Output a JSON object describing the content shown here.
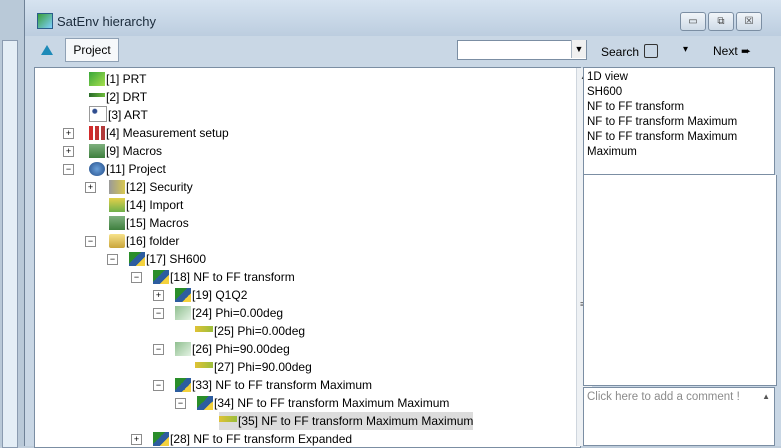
{
  "window": {
    "title": "SatEnv hierarchy",
    "minimize": "▭",
    "maximize": "⧉",
    "close": "☒"
  },
  "toolbar": {
    "project_label": "Project",
    "search_value": "",
    "search_label": "Search",
    "search_dropdown": "▾",
    "next_label": "Next"
  },
  "tree": [
    {
      "label": "[1] PRT",
      "icon": "arrow-green-icon"
    },
    {
      "label": "[2] DRT",
      "icon": "receiver-icon"
    },
    {
      "label": "[3] ART",
      "icon": "network-icon"
    },
    {
      "label": "[4] Measurement setup",
      "icon": "matrix-icon"
    },
    {
      "label": "[9] Macros",
      "icon": "macro-icon"
    },
    {
      "label": "[11] Project",
      "icon": "globe-icon"
    },
    {
      "label": "[12] Security",
      "icon": "key-icon"
    },
    {
      "label": "[14] Import",
      "icon": "house-icon"
    },
    {
      "label": "[15] Macros",
      "icon": "macro-icon"
    },
    {
      "label": "[16] folder",
      "icon": "folder-open-icon"
    },
    {
      "label": "[17] SH600",
      "icon": "sh-icon"
    },
    {
      "label": "[18] NF to FF transform",
      "icon": "sh-icon"
    },
    {
      "label": "[19] Q1Q2",
      "icon": "sh-icon"
    },
    {
      "label": "[24] Phi=0.00deg",
      "icon": "phi-icon"
    },
    {
      "label": "[25] Phi=0.00deg",
      "icon": "line-icon"
    },
    {
      "label": "[26] Phi=90.00deg",
      "icon": "phi-icon"
    },
    {
      "label": "[27] Phi=90.00deg",
      "icon": "line-icon"
    },
    {
      "label": "[33] NF to FF transform Maximum",
      "icon": "sh-icon"
    },
    {
      "label": "[34] NF to FF transform Maximum Maximum",
      "icon": "sh-icon"
    },
    {
      "label": "[35] NF to FF transform Maximum Maximum",
      "icon": "line-icon"
    },
    {
      "label": "[28] NF to FF transform Expanded",
      "icon": "sh-icon"
    }
  ],
  "info": {
    "lines": [
      "1D view",
      "SH600",
      "NF to FF transform",
      "NF to FF transform Maximum",
      "NF to FF transform Maximum",
      "Maximum"
    ]
  },
  "comment": {
    "placeholder": "Click here to add a comment !"
  }
}
